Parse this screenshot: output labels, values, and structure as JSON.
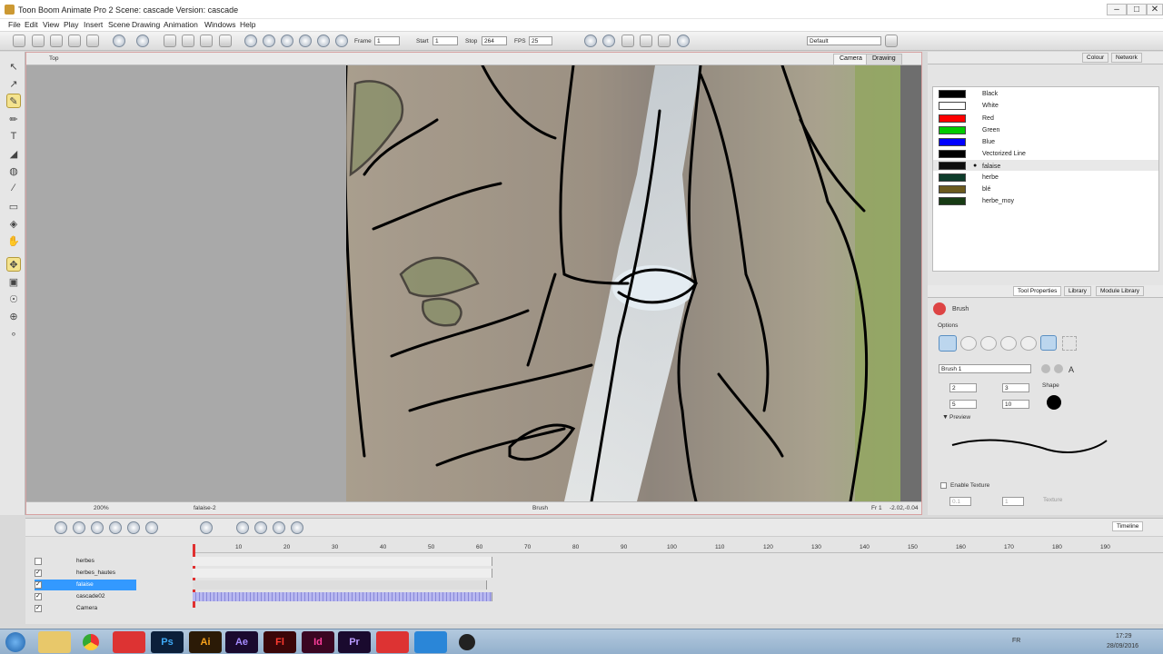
{
  "window": {
    "title": "Toon Boom Animate Pro 2 Scene: cascade Version: cascade",
    "min": "–",
    "max": "□",
    "close": "✕"
  },
  "menu": [
    "File",
    "Edit",
    "View",
    "Play",
    "Insert",
    "Scene",
    "Drawing",
    "Animation",
    "Windows",
    "Help"
  ],
  "toolbar": {
    "frame_label": "Frame",
    "frame_value": "1",
    "start_label": "Start",
    "start_value": "1",
    "stop_label": "Stop",
    "stop_value": "264",
    "fps_label": "FPS",
    "fps_value": "25",
    "workspace": "Default"
  },
  "viewport": {
    "view_label": "Top",
    "tab_camera": "Camera",
    "tab_drawing": "Drawing",
    "zoom": "200%",
    "layer_name": "falaise-2",
    "tool_name": "Brush",
    "frame_info": "Fr 1",
    "coords": "-2.02,-0.04"
  },
  "colour_panel": {
    "tab_colour": "Colour",
    "tab_network": "Network",
    "swatches": [
      {
        "name": "Black",
        "color": "#000000"
      },
      {
        "name": "White",
        "color": "#ffffff"
      },
      {
        "name": "Red",
        "color": "#ff0000"
      },
      {
        "name": "Green",
        "color": "#00cc00"
      },
      {
        "name": "Blue",
        "color": "#0000ff"
      },
      {
        "name": "Vectorized Line",
        "color": "#000000"
      },
      {
        "name": "falaise",
        "color": "#0d0d0d"
      },
      {
        "name": "herbe",
        "color": "#0d3b2a"
      },
      {
        "name": "blé",
        "color": "#6b5a1e"
      },
      {
        "name": "herbe_moy",
        "color": "#173b14"
      }
    ],
    "selected_index": 6
  },
  "tool_properties": {
    "tab_props": "Tool Properties",
    "tab_library": "Library",
    "tab_module": "Module Library",
    "tool": "Brush",
    "options_label": "Options",
    "preset": "Brush 1",
    "min_size": "2",
    "max_size": "3",
    "smoothing": "5",
    "min_smoothing": "10",
    "shape_label": "Shape",
    "preview_label": "Preview",
    "texture_label": "Enable Texture",
    "texture_field": "Texture",
    "tex_a": "0.1",
    "tex_b": "1"
  },
  "timeline": {
    "tab": "Timeline",
    "ruler": [
      "10",
      "20",
      "30",
      "40",
      "50",
      "60",
      "70",
      "80",
      "90",
      "100",
      "110",
      "120",
      "130",
      "140",
      "150",
      "160",
      "170",
      "180",
      "190"
    ],
    "layers": [
      {
        "name": "herbes",
        "checked": false,
        "selected": false
      },
      {
        "name": "herbes_hautes",
        "checked": true,
        "selected": false
      },
      {
        "name": "falaise",
        "checked": true,
        "selected": true
      },
      {
        "name": "cascade02",
        "checked": true,
        "selected": false
      },
      {
        "name": "Camera",
        "checked": true,
        "selected": false
      }
    ]
  },
  "taskbar": {
    "apps": [
      "Ai",
      "Ae",
      "Fl",
      "Id",
      "Pr"
    ],
    "ps": "Ps",
    "lang": "FR",
    "time": "17:29",
    "date": "28/09/2016"
  }
}
